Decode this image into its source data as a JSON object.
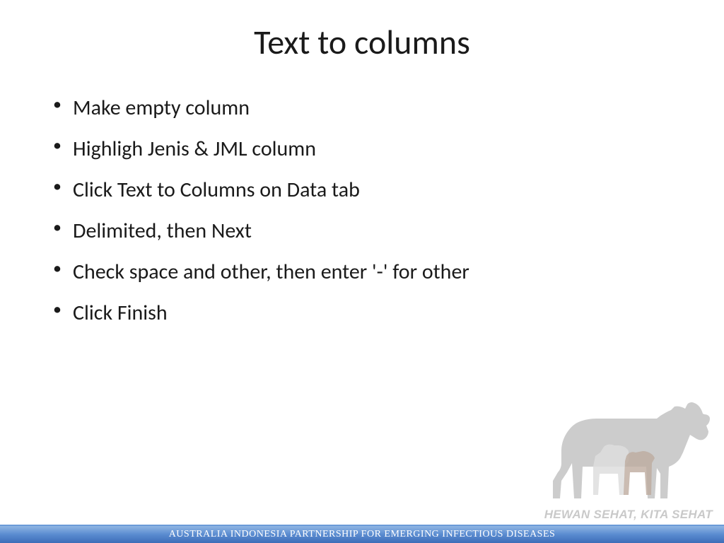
{
  "title": "Text to columns",
  "bullets": [
    "Make empty column",
    "Highligh Jenis & JML column",
    "Click Text to Columns on Data tab",
    "Delimited, then Next",
    "Check space and other, then enter '-' for other",
    "Click Finish"
  ],
  "footer": "AUSTRALIA INDONESIA PARTNERSHIP FOR EMERGING INFECTIOUS DISEASES",
  "logo_tagline": "HEWAN SEHAT, KITA SEHAT"
}
